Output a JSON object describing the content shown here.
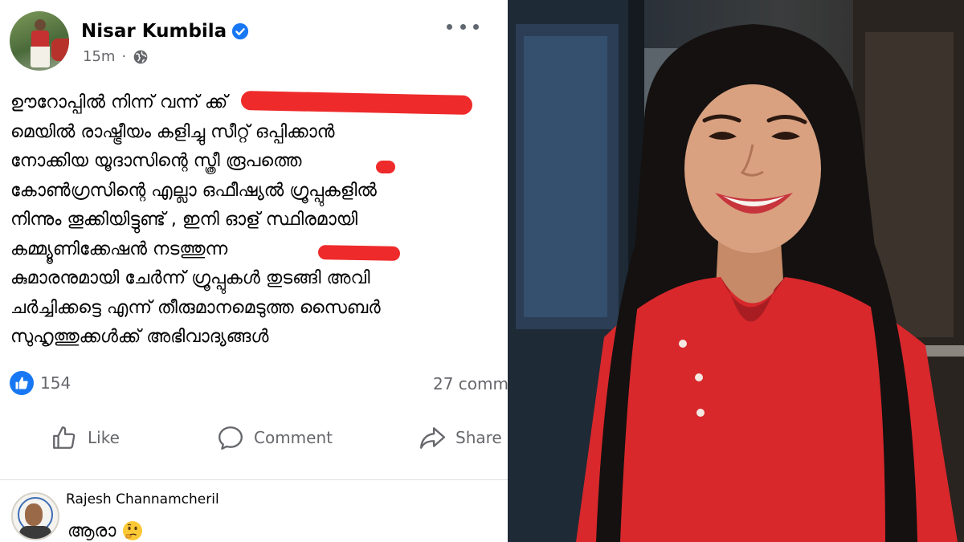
{
  "post": {
    "author": "Nisar Kumbila",
    "time": "15m",
    "separator": "·",
    "lines": [
      "ഊറോപ്പിൽ നിന്ന് വന്ന്                                  ക്ക്",
      "മെയിൽ രാഷ്ട്രീയം കളിച്ചു സീറ്റ് ഒപ്പിക്കാൻ",
      "നോക്കിയ യൂദാസിന്റെ സ്ത്രീ രൂപത്തെ",
      "കോൺഗ്രസിന്റെ എല്ലാ ഒഫീഷ്യൽ ഗ്രൂപ്പുകളിൽ",
      "നിന്നും തൂക്കിയിട്ടുണ്ട് , ഇനി ഓള് സ്ഥിരമായി",
      "കമ്മ്യൂണിക്കേഷൻ നടത്തുന്ന",
      "കുമാരനുമായി ചേർന്ന് ഗ്രൂപ്പുകൾ തുടങ്ങി അവി",
      "ചർച്ചിക്കട്ടെ എന്ന് തീരുമാനമെടുത്ത സൈബർ",
      "സുഹൃത്തുക്കൾക്ക് അഭിവാദ്യങ്ങൾ"
    ],
    "reaction_count": "154",
    "comment_count": "27 comme"
  },
  "actions": {
    "like": "Like",
    "comment": "Comment",
    "share": "Share"
  },
  "comment": {
    "author": "Rajesh Channamcheril",
    "text": "ആരാ"
  },
  "colors": {
    "redaction": "#ee2a2a",
    "fb_blue": "#1877f2",
    "muted": "#65676b"
  },
  "icons": [
    "verified-icon",
    "globe-icon",
    "more-icon",
    "like-icon",
    "comment-icon",
    "share-icon",
    "thinking-face-icon"
  ]
}
